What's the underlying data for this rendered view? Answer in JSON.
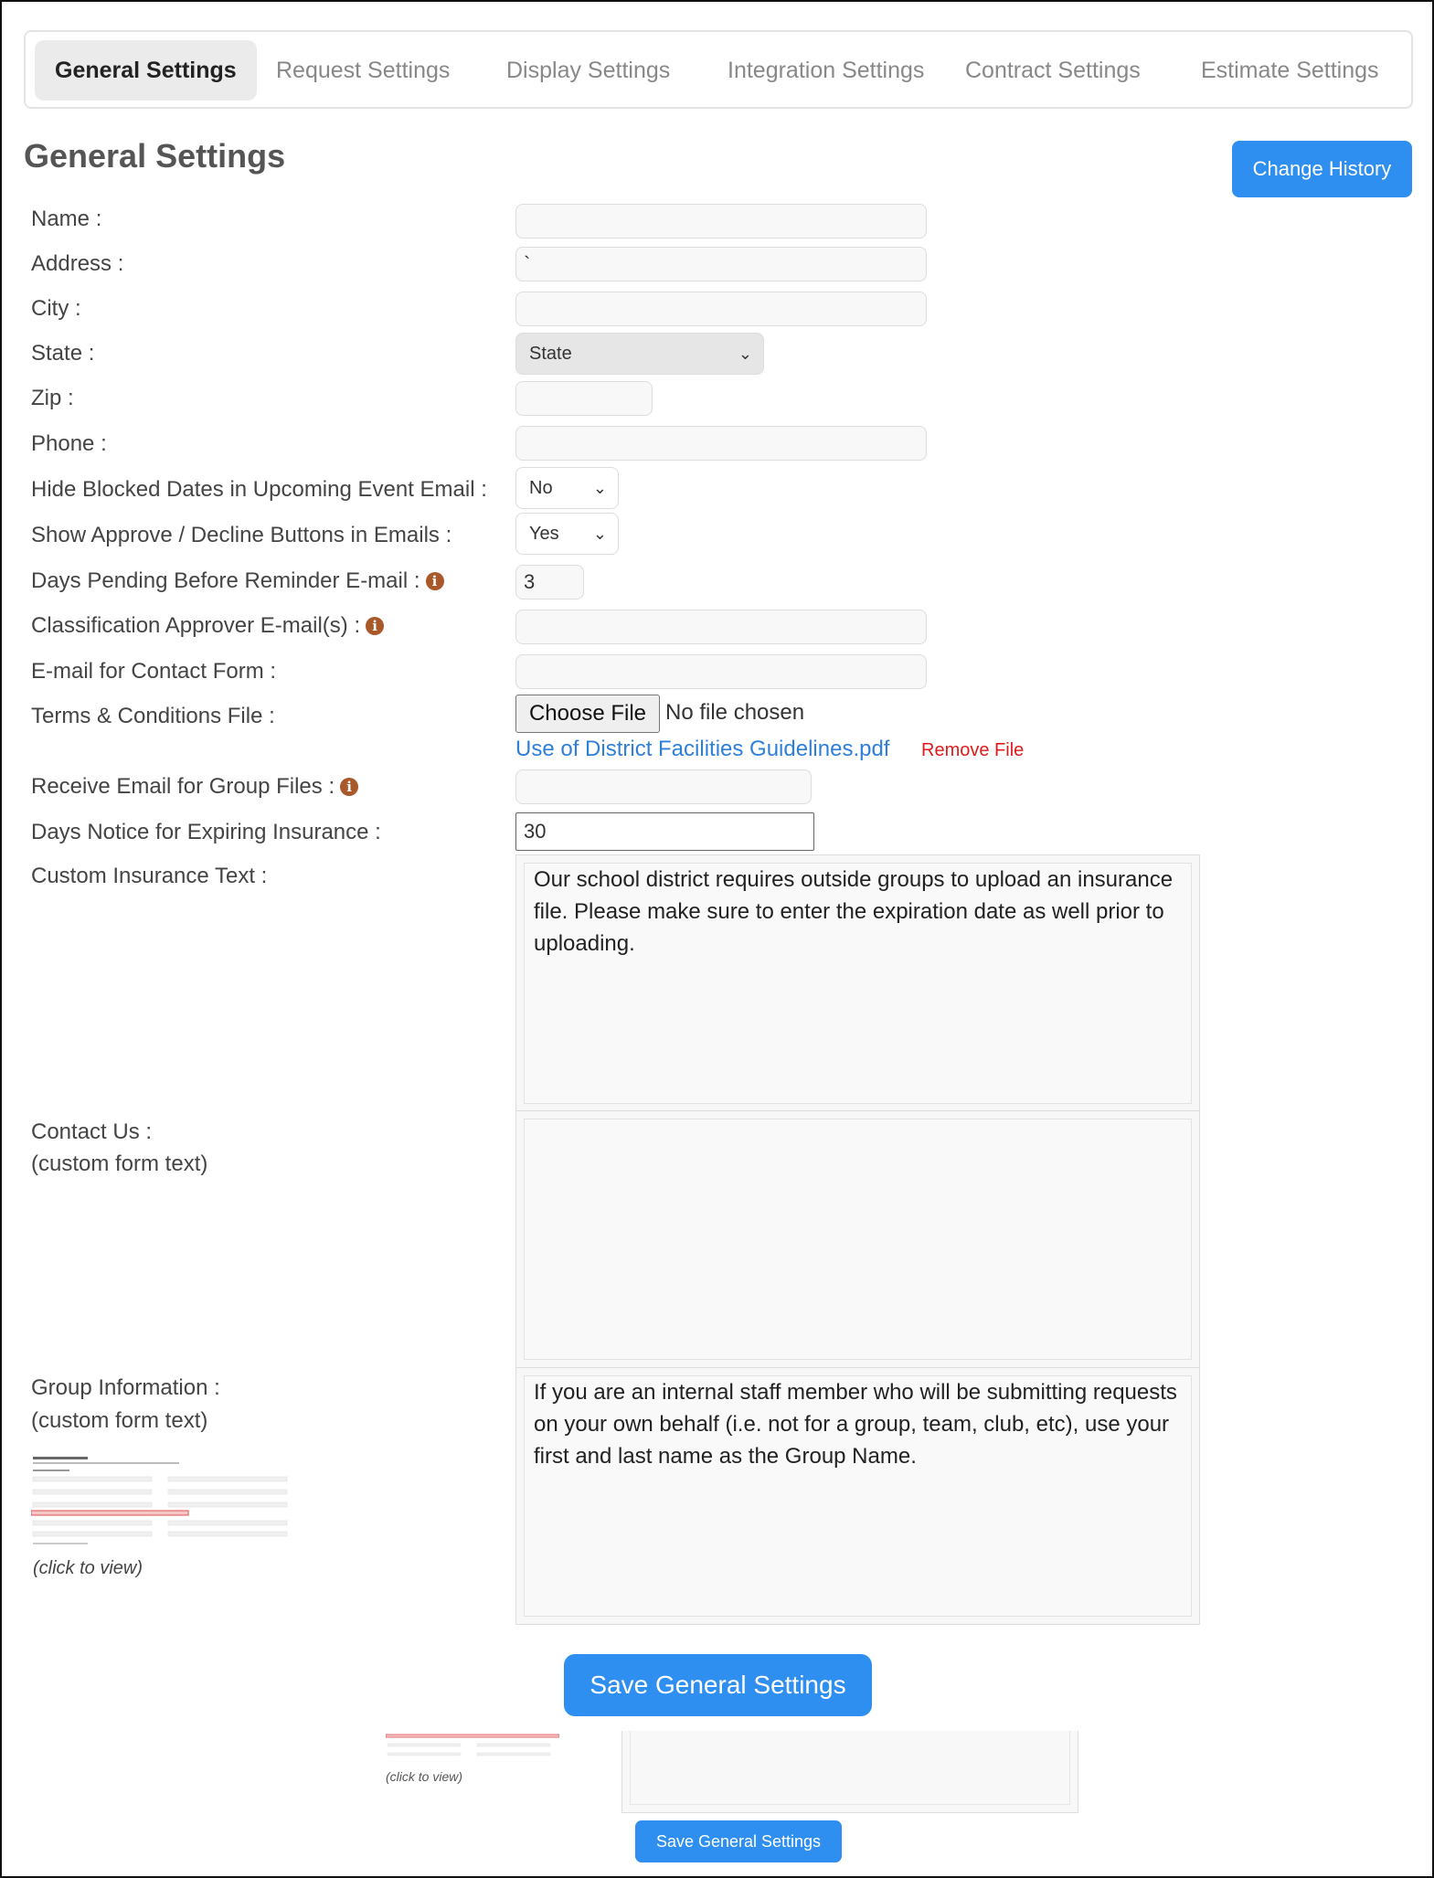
{
  "tabs": [
    {
      "label": "General Settings",
      "active": true
    },
    {
      "label": "Request Settings",
      "active": false
    },
    {
      "label": "Display Settings",
      "active": false
    },
    {
      "label": "Integration Settings",
      "active": false
    },
    {
      "label": "Contract Settings",
      "active": false
    },
    {
      "label": "Estimate Settings",
      "active": false
    }
  ],
  "page_title": "General Settings",
  "change_history_label": "Change History",
  "fields": {
    "name": {
      "label": "Name :",
      "value": ""
    },
    "address": {
      "label": "Address :",
      "value": "`"
    },
    "city": {
      "label": "City :",
      "value": ""
    },
    "state": {
      "label": "State :",
      "value": "State"
    },
    "zip": {
      "label": "Zip :",
      "value": ""
    },
    "phone": {
      "label": "Phone :",
      "value": ""
    },
    "hide_blocked": {
      "label": "Hide Blocked Dates in Upcoming Event Email :",
      "value": "No"
    },
    "show_approve": {
      "label": "Show Approve / Decline Buttons in Emails :",
      "value": "Yes"
    },
    "days_pending": {
      "label": "Days Pending Before Reminder E-mail :",
      "value": "3"
    },
    "classification_approver": {
      "label": "Classification Approver E-mail(s) :",
      "value": ""
    },
    "contact_form_email": {
      "label": "E-mail for Contact Form :",
      "value": ""
    },
    "terms_file": {
      "label": "Terms & Conditions File :",
      "button": "Choose File",
      "status": "No file chosen",
      "current_file": "Use of District Facilities Guidelines.pdf",
      "remove": "Remove File"
    },
    "group_files_email": {
      "label": "Receive Email for Group Files :",
      "value": ""
    },
    "days_notice_insurance": {
      "label": "Days Notice for Expiring Insurance :",
      "value": "30"
    },
    "custom_insurance_text": {
      "label": "Custom Insurance Text :",
      "value": "Our school district requires outside groups to upload an insurance file. Please make sure to enter the expiration date as well prior to uploading."
    },
    "contact_us": {
      "label_line1": "Contact Us :",
      "label_line2": "(custom form text)",
      "value": ""
    },
    "group_information": {
      "label_line1": "Group Information :",
      "label_line2": "(custom form text)",
      "value": "If you are an internal staff member who will be submitting requests on your own behalf (i.e. not for a group, team, club, etc), use your first and last name as the Group Name.",
      "thumbnail_caption": "(click to view)"
    }
  },
  "save_label": "Save General Settings",
  "ghost": {
    "caption": "(click to view)",
    "save_label": "Save General Settings"
  },
  "colors": {
    "primary": "#2e8ff0",
    "info_icon": "#a9582a",
    "remove_link": "#e01b1b",
    "file_link": "#2f7fd8"
  }
}
